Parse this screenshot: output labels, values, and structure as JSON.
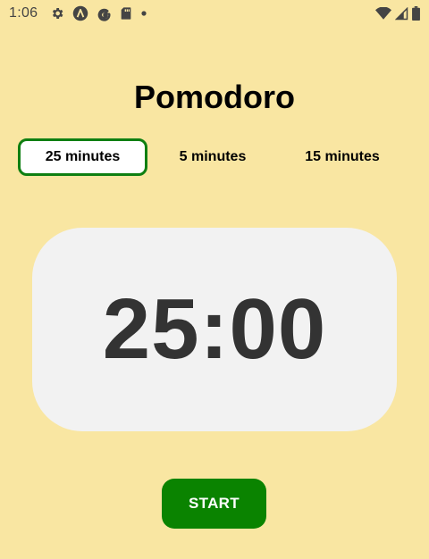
{
  "status_bar": {
    "time": "1:06",
    "left_icons": [
      "settings-icon",
      "a-circle-icon",
      "google-g-icon",
      "sd-card-icon",
      "dot-icon"
    ],
    "right_icons": [
      "wifi-icon",
      "signal-icon",
      "battery-icon"
    ]
  },
  "header": {
    "title": "Pomodoro"
  },
  "tabs": [
    {
      "label": "25 minutes",
      "active": true
    },
    {
      "label": "5 minutes",
      "active": false
    },
    {
      "label": "15 minutes",
      "active": false
    }
  ],
  "timer": {
    "display": "25:00"
  },
  "controls": {
    "start_label": "START"
  },
  "colors": {
    "background": "#f9e6a2",
    "accent": "#0a8300",
    "card": "#f2f2f2",
    "timer_text": "#333333"
  }
}
